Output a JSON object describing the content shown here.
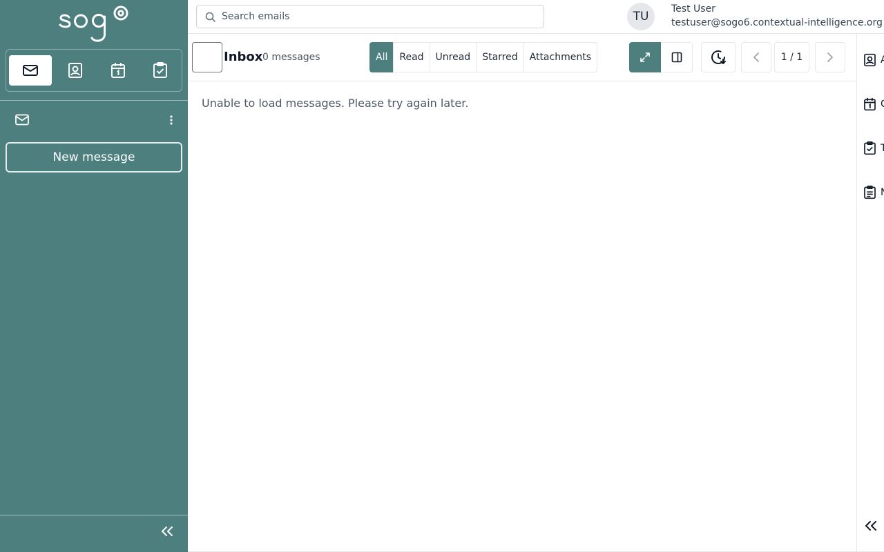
{
  "brand": {
    "logo_text": "sogo"
  },
  "sidebar": {
    "apps": [
      {
        "icon": "mail-icon",
        "name": "Mail",
        "active": true
      },
      {
        "icon": "contacts-icon",
        "name": "Contacts",
        "active": false
      },
      {
        "icon": "calendar-icon",
        "name": "Calendar",
        "active": false
      },
      {
        "icon": "tasks-icon",
        "name": "Tasks",
        "active": false
      }
    ],
    "account_icon": "mail-icon",
    "new_message_label": "New message",
    "collapse_icon": "double-chevron-left-icon"
  },
  "header": {
    "search_placeholder": "Search emails",
    "avatar_initials": "TU",
    "user_name": "Test User",
    "user_email": "testuser@sogo6.contextual-intelligence.org"
  },
  "toolbar": {
    "folder_title": "Inbox",
    "message_count": "0 messages",
    "filters": [
      {
        "label": "All",
        "active": true
      },
      {
        "label": "Read",
        "active": false
      },
      {
        "label": "Unread",
        "active": false
      },
      {
        "label": "Starred",
        "active": false
      },
      {
        "label": "Attachments",
        "active": false
      }
    ],
    "view_modes": [
      "expand-icon",
      "split-pane-icon"
    ],
    "refresh_icon": "refresh-icon",
    "page_indicator": "1 / 1"
  },
  "main": {
    "status_text": "Unable to load messages. Please try again later."
  },
  "right_rail": {
    "items": [
      {
        "icon": "contacts-icon",
        "label": "A"
      },
      {
        "icon": "calendar-icon",
        "label": "C"
      },
      {
        "icon": "tasks-icon",
        "label": "T"
      },
      {
        "icon": "notes-icon",
        "label": "N"
      }
    ]
  },
  "colors": {
    "accent": "#4d7f7f",
    "sidebar_bg": "#4d7f7f"
  }
}
